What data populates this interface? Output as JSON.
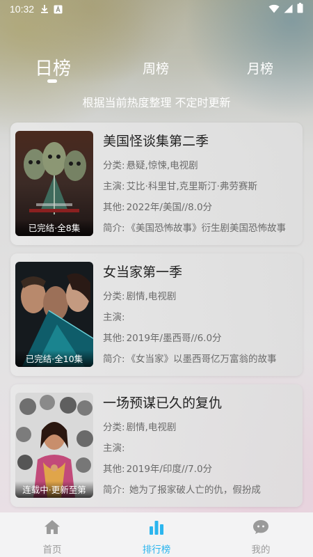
{
  "status_bar": {
    "time": "10:32"
  },
  "tabs": [
    {
      "label": "日榜",
      "active": true
    },
    {
      "label": "周榜",
      "active": false
    },
    {
      "label": "月榜",
      "active": false
    }
  ],
  "subtitle": "根据当前热度整理 不定时更新",
  "labels": {
    "category": "分类:",
    "cast": "主演:",
    "other": "其他:",
    "intro": "简介:"
  },
  "items": [
    {
      "title": "美国怪谈集第二季",
      "poster_tag": "已完结·全8集",
      "category": "悬疑,惊悚,电视剧",
      "cast": "艾比·科里甘,克里斯汀·弗劳赛斯",
      "other": "2022年/美国//8.0分",
      "intro": "《美国恐怖故事》衍生剧美国恐怖故事"
    },
    {
      "title": "女当家第一季",
      "poster_tag": "已完结·全10集",
      "category": "剧情,电视剧",
      "cast": "",
      "other": "2019年/墨西哥//6.0分",
      "intro": "《女当家》以墨西哥亿万富翁的故事"
    },
    {
      "title": "一场预谋已久的复仇",
      "poster_tag": "连载中·更新至第",
      "category": "剧情,电视剧",
      "cast": "",
      "other": "2019年/印度//7.0分",
      "intro": "  她为了报家破人亡的仇，假扮成"
    }
  ],
  "nav": [
    {
      "label": "首页",
      "icon": "home-icon",
      "active": false
    },
    {
      "label": "排行榜",
      "icon": "chart-icon",
      "active": true
    },
    {
      "label": "我的",
      "icon": "chat-face-icon",
      "active": false
    }
  ],
  "colors": {
    "accent": "#2bb5ee",
    "inactive": "#9a9a9a"
  }
}
